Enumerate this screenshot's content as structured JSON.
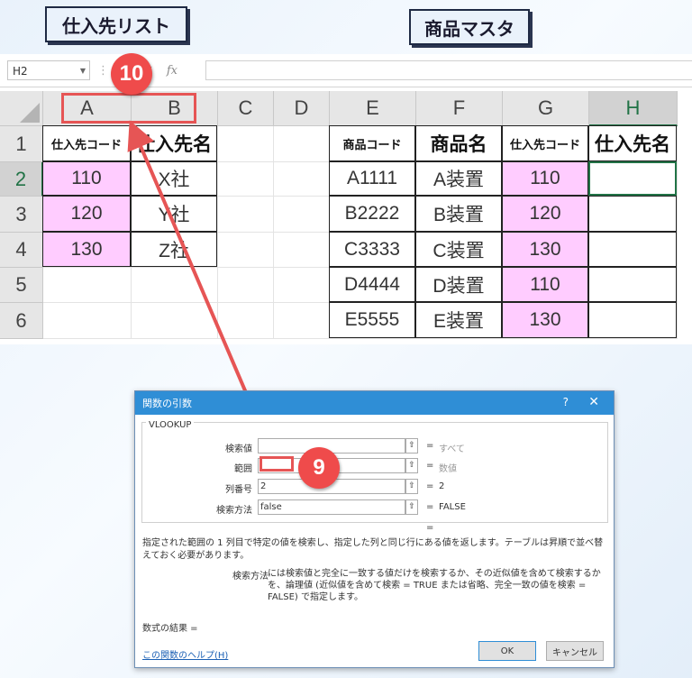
{
  "labels": {
    "supplier_list": "仕入先リスト",
    "product_master": "商品マスタ"
  },
  "formula_bar": {
    "name_box": "H2",
    "fx": "fx",
    "cancel_icon": "✕",
    "enter_icon": "✓"
  },
  "columns": [
    "A",
    "B",
    "C",
    "D",
    "E",
    "F",
    "G",
    "H"
  ],
  "rows": [
    "1",
    "2",
    "3",
    "4",
    "5",
    "6"
  ],
  "supplier_table": {
    "headers": [
      "仕入先コード",
      "仕入先名"
    ],
    "rows": [
      [
        "110",
        "X社"
      ],
      [
        "120",
        "Y社"
      ],
      [
        "130",
        "Z社"
      ]
    ]
  },
  "product_table": {
    "headers": [
      "商品コード",
      "商品名",
      "仕入先コード",
      "仕入先名"
    ],
    "rows": [
      [
        "A1111",
        "A装置",
        "110",
        ""
      ],
      [
        "B2222",
        "B装置",
        "120",
        ""
      ],
      [
        "C3333",
        "C装置",
        "130",
        ""
      ],
      [
        "D4444",
        "D装置",
        "110",
        ""
      ],
      [
        "E5555",
        "E装置",
        "130",
        ""
      ]
    ]
  },
  "badges": {
    "step10": "10",
    "step9": "9"
  },
  "dialog": {
    "title": "関数の引数",
    "help_icon": "?",
    "close_icon": "✕",
    "function_name": "VLOOKUP",
    "args": [
      {
        "label": "検索値",
        "value": "",
        "result": "すべて"
      },
      {
        "label": "範囲",
        "value": "",
        "result": "数値"
      },
      {
        "label": "列番号",
        "value": "2",
        "result": "2"
      },
      {
        "label": "検索方法",
        "value": "false",
        "result": "FALSE"
      }
    ],
    "equals": "=",
    "description": "指定された範囲の 1 列目で特定の値を検索し、指定した列と同じ行にある値を返します。テーブルは昇順で並べ替えておく必要があります。",
    "param_label": "検索方法",
    "param_desc": "には検索値と完全に一致する値だけを検索するか、その近似値を含めて検索するかを、論理値 (近似値を含めて検索 = TRUE または省略、完全一致の値を検索 = FALSE) で指定します。",
    "formula_result": "数式の結果 =",
    "help_link": "この関数のヘルプ(H)",
    "ok": "OK",
    "cancel": "キャンセル"
  },
  "colors": {
    "pink": "#ffccff",
    "excel_green": "#217346",
    "annotation_red": "#e65555",
    "dialog_title": "#2f8ed6"
  }
}
